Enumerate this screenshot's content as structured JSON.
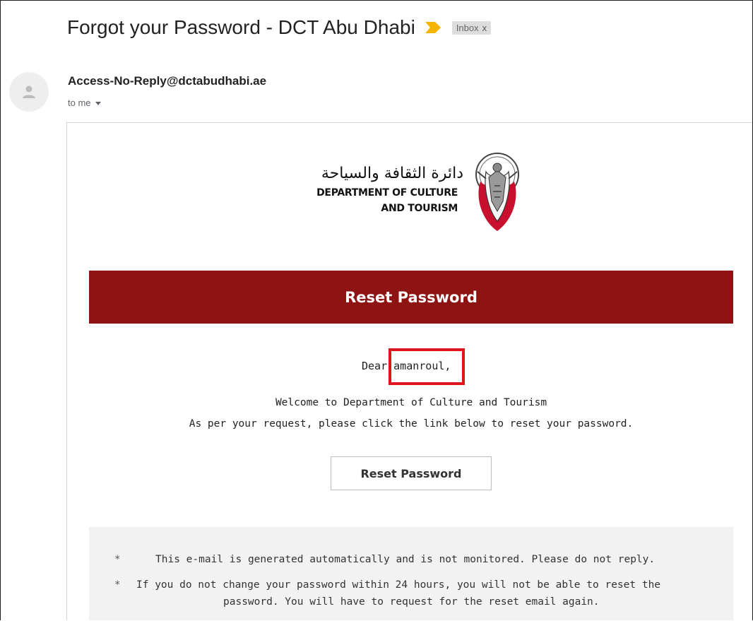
{
  "header": {
    "subject": "Forgot your Password - DCT Abu Dhabi",
    "importance_icon": "importance-marker-icon",
    "label": "Inbox",
    "label_close": "x",
    "colors": {
      "importance": "#f4b400",
      "label_bg": "#dddddd"
    }
  },
  "sender": {
    "avatar_icon": "person-icon",
    "address": "Access-No-Reply@dctabudhabi.ae",
    "recipient": "to me"
  },
  "email": {
    "logo": {
      "arabic": "دائرة الثقافة والسياحة",
      "line1": "DEPARTMENT OF CULTURE",
      "line2": "AND TOURISM",
      "emblem_icon": "abu-dhabi-falcon-emblem-icon"
    },
    "banner_title": "Reset Password",
    "greeting_prefix": "Dear",
    "greeting_name": "amanroul,",
    "welcome_line1": "Welcome to Department of Culture and Tourism",
    "welcome_line2": "As per your request, please click the link below to reset your password.",
    "button_label": "Reset Password",
    "notes": [
      "This e-mail is generated automatically and is not monitored. Please do not reply.",
      "If you do not change your password within 24 hours, you will not be able to reset the",
      "password. You will have to request for the reset email again."
    ],
    "note_marker": "*",
    "colors": {
      "banner": "#8e1414",
      "highlight": "#e0141e",
      "footer_bg": "#f2f2f2"
    }
  }
}
